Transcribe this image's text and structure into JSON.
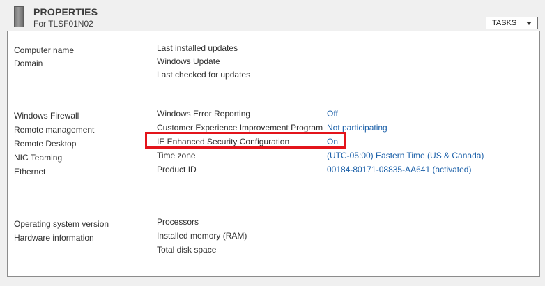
{
  "header": {
    "title": "PROPERTIES",
    "subtitle": "For TLSF01N02",
    "tasks_label": "TASKS",
    "icon": "server-icon"
  },
  "section1": {
    "left_labels": [
      "Computer name",
      "Domain"
    ],
    "right_labels": [
      "Last installed updates",
      "Windows Update",
      "Last checked for updates"
    ]
  },
  "section2": {
    "left_labels": [
      "Windows Firewall",
      "Remote management",
      "Remote Desktop",
      "NIC Teaming",
      "Ethernet"
    ],
    "right_rows": [
      {
        "label": "Windows Error Reporting",
        "value": "Off"
      },
      {
        "label": "Customer Experience Improvement Program",
        "value": "Not participating"
      },
      {
        "label": "IE Enhanced Security Configuration",
        "value": "On"
      },
      {
        "label": "Time zone",
        "value": "(UTC-05:00) Eastern Time (US & Canada)"
      },
      {
        "label": "Product ID",
        "value": "00184-80171-08835-AA641 (activated)"
      }
    ]
  },
  "section3": {
    "left_labels": [
      "Operating system version",
      "Hardware information"
    ],
    "right_labels": [
      "Processors",
      "Installed memory (RAM)",
      "Total disk space"
    ]
  },
  "colors": {
    "link": "#1a5fa8",
    "highlight": "#e3141b",
    "text": "#2e2e2e"
  }
}
